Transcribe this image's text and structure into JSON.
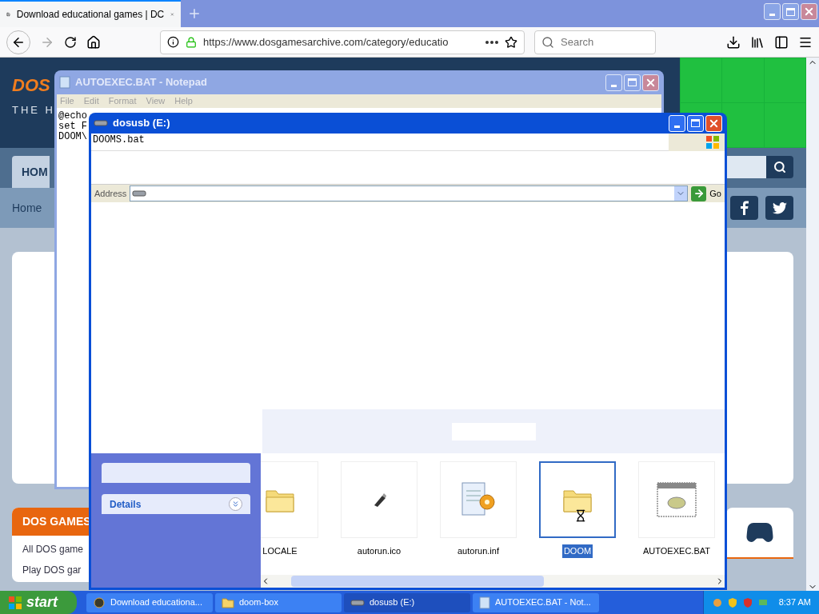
{
  "browser": {
    "tab": {
      "title": "Download educational games | DC"
    },
    "url": "https://www.dosgamesarchive.com/category/educatio",
    "search": {
      "placeholder": "Search"
    }
  },
  "site": {
    "logo": "DOS",
    "tagline": "THE H",
    "nav": [
      {
        "label": "HOM",
        "selected": true
      }
    ],
    "breadcrumb": "Home",
    "sidebar": {
      "title": "DOS GAMES",
      "links": [
        "All DOS game",
        "Play DOS gar"
      ]
    }
  },
  "notepad": {
    "title": "AUTOEXEC.BAT - Notepad",
    "menu": [
      "File",
      "Edit",
      "Format",
      "View",
      "Help"
    ],
    "lines": [
      "@echo",
      "set F",
      "DOOM\\"
    ]
  },
  "explorer": {
    "title": "dosusb (E:)",
    "ghost_text": "DOOMS.bat",
    "address_label": "Address",
    "go": "Go",
    "panels": [
      {
        "expanded": false
      },
      {
        "title": "Details",
        "expanded": false
      }
    ],
    "files": [
      {
        "name": "LOCALE",
        "kind": "folder",
        "selected": false
      },
      {
        "name": "autorun.ico",
        "kind": "usb",
        "selected": false
      },
      {
        "name": "autorun.inf",
        "kind": "inf",
        "selected": false
      },
      {
        "name": "DOOM",
        "kind": "folder",
        "selected": true
      },
      {
        "name": "AUTOEXEC.BAT",
        "kind": "batch",
        "selected": false
      }
    ]
  },
  "taskbar": {
    "start": "start",
    "tasks": [
      {
        "label": "Download educationa...",
        "kind": "browser",
        "selected": false
      },
      {
        "label": "doom-box",
        "kind": "folder",
        "selected": false
      },
      {
        "label": "dosusb (E:)",
        "kind": "drive",
        "selected": true
      },
      {
        "label": "AUTOEXEC.BAT - Not...",
        "kind": "notepad",
        "selected": false
      }
    ],
    "clock": "8:37 AM"
  }
}
